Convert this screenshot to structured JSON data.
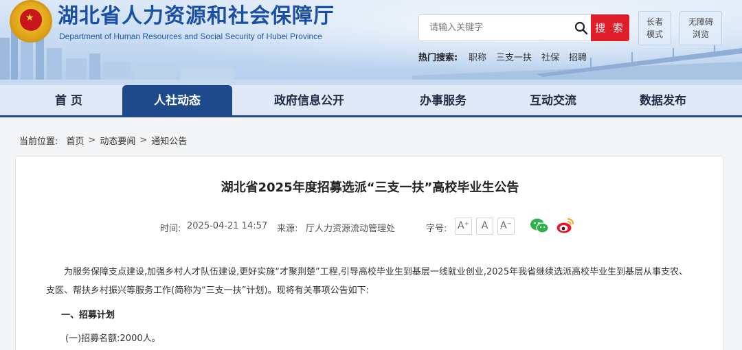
{
  "header": {
    "title": "湖北省人力资源和社会保障厅",
    "subtitle": "Department of Human Resources and Social Security of Hubei Province",
    "search": {
      "placeholder": "请输入关键字",
      "button_label": "搜 索"
    },
    "modes": {
      "elder_line1": "长者",
      "elder_line2": "模式",
      "access_line1": "无障碍",
      "access_line2": "浏览"
    },
    "hot_search": {
      "label": "热门搜索:",
      "items": [
        "职称",
        "三支一扶",
        "社保",
        "招聘"
      ]
    }
  },
  "nav": {
    "items": [
      "首  页",
      "人社动态",
      "政府信息公开",
      "办事服务",
      "互动交流",
      "数据发布"
    ],
    "active_index": 1
  },
  "breadcrumb": {
    "label": "当前位置:",
    "items": [
      "首页",
      "动态要闻",
      "通知公告"
    ],
    "separator": ">"
  },
  "article": {
    "title": "湖北省2025年度招募选派“三支一扶”高校毕业生公告",
    "time_label": "时间:",
    "time": "2025-04-21 14:57",
    "source_label": "来源:",
    "source": "厅人力资源流动管理处",
    "font_label": "字号:",
    "font_buttons": [
      "A⁺",
      "A",
      "A⁻"
    ],
    "paragraph1": "为服务保障支点建设,加强乡村人才队伍建设,更好实施“才聚荆楚”工程,引导高校毕业生到基层一线就业创业,2025年我省继续选派高校毕业生到基层从事支农、支医、帮扶乡村振兴等服务工作(简称为“三支一扶”计划)。现将有关事项公告如下:",
    "section1_heading": "一、招募计划",
    "section1_item1": "(一)招募名额:2000人。"
  },
  "colors": {
    "nav_active": "#1e4a8c",
    "search_button": "#e01e2a",
    "title_blue": "#1a4fa3"
  }
}
